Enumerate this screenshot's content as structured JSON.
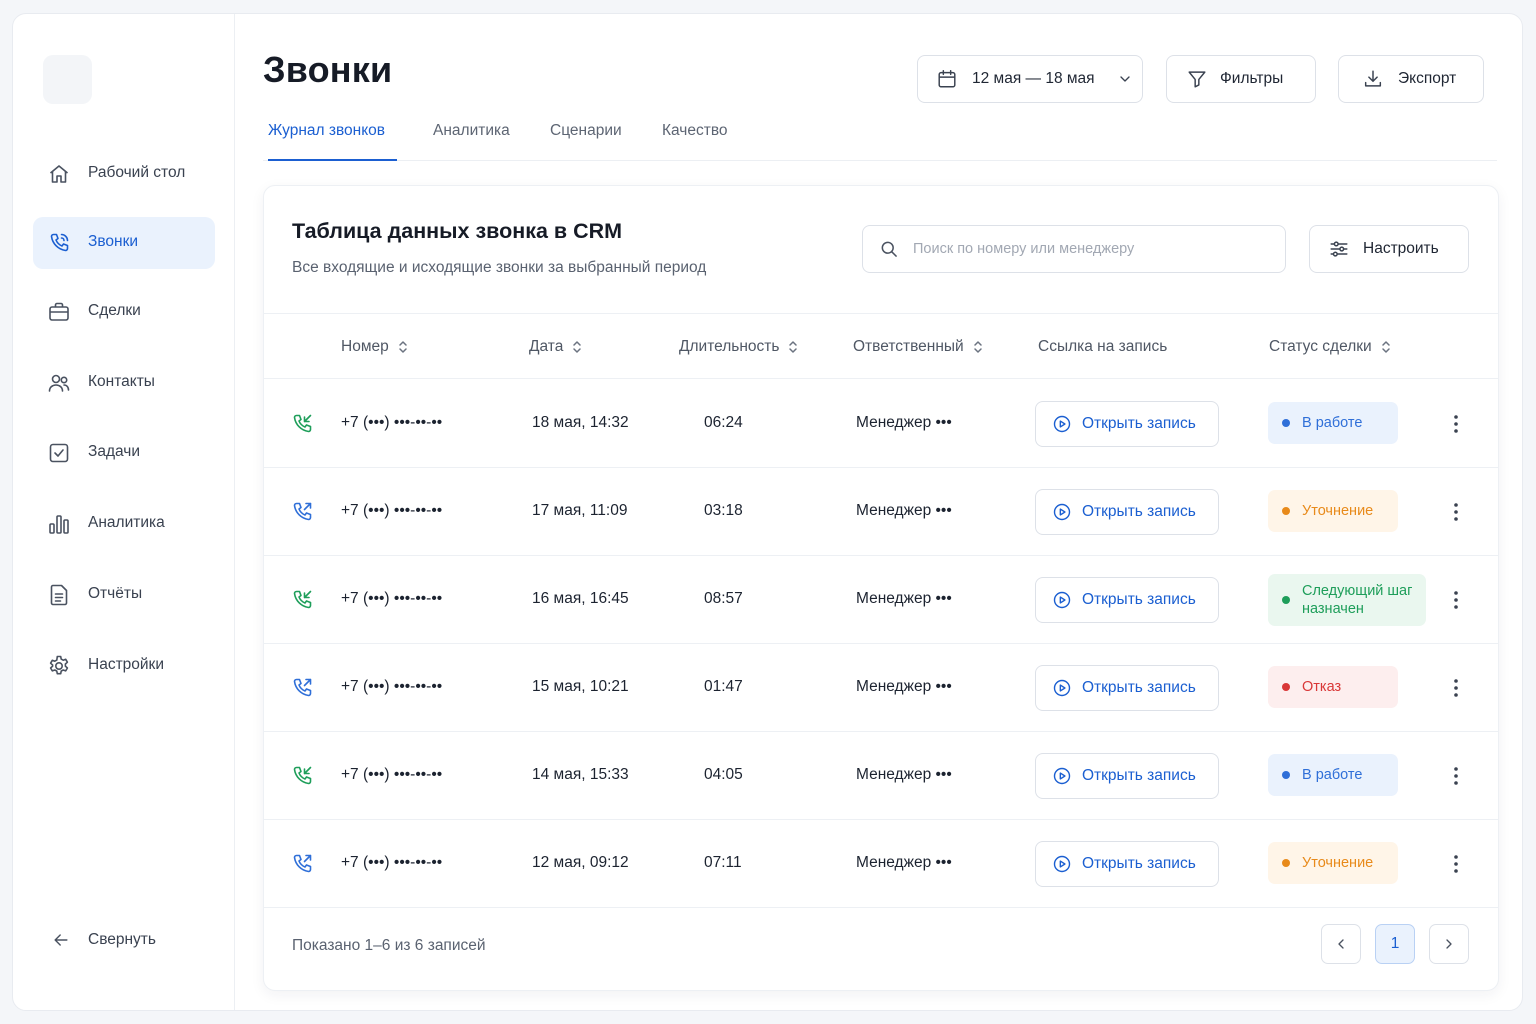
{
  "sidebar": {
    "items": [
      {
        "label": "Рабочий стол",
        "icon": "home-icon"
      },
      {
        "label": "Звонки",
        "icon": "phone-icon",
        "active": true
      },
      {
        "label": "Сделки",
        "icon": "briefcase-icon"
      },
      {
        "label": "Контакты",
        "icon": "users-icon"
      },
      {
        "label": "Задачи",
        "icon": "checkbox-icon"
      },
      {
        "label": "Аналитика",
        "icon": "bar-chart-icon"
      },
      {
        "label": "Отчёты",
        "icon": "document-icon"
      },
      {
        "label": "Настройки",
        "icon": "gear-icon"
      }
    ],
    "collapse_label": "Свернуть"
  },
  "header": {
    "title": "Звонки",
    "date_range": "12 мая — 18 мая",
    "filters_label": "Фильтры",
    "export_label": "Экспорт"
  },
  "tabs": [
    {
      "label": "Журнал звонков",
      "active": true
    },
    {
      "label": "Аналитика"
    },
    {
      "label": "Сценарии"
    },
    {
      "label": "Качество"
    }
  ],
  "card": {
    "title": "Таблица данных звонка в CRM",
    "subtitle": "Все входящие и исходящие звонки за выбранный период",
    "search_placeholder": "Поиск по номеру или менеджеру",
    "configure_label": "Настроить"
  },
  "table": {
    "columns": [
      "Номер",
      "Дата",
      "Длительность",
      "Ответственный",
      "Ссылка на запись",
      "Статус сделки"
    ],
    "record_label": "Открыть запись",
    "rows": [
      {
        "direction": "incoming",
        "number": "+7 (•••) •••-••-••",
        "date": "18 мая, 14:32",
        "duration": "06:24",
        "manager": "Менеджер •••",
        "status": "В работе",
        "status_type": "blue"
      },
      {
        "direction": "outgoing",
        "number": "+7 (•••) •••-••-••",
        "date": "17 мая, 11:09",
        "duration": "03:18",
        "manager": "Менеджер •••",
        "status": "Уточнение",
        "status_type": "orange"
      },
      {
        "direction": "incoming",
        "number": "+7 (•••) •••-••-••",
        "date": "16 мая, 16:45",
        "duration": "08:57",
        "manager": "Менеджер •••",
        "status": "Следующий шаг назначен",
        "status_type": "green"
      },
      {
        "direction": "outgoing",
        "number": "+7 (•••) •••-••-••",
        "date": "15 мая, 10:21",
        "duration": "01:47",
        "manager": "Менеджер •••",
        "status": "Отказ",
        "status_type": "red"
      },
      {
        "direction": "incoming",
        "number": "+7 (•••) •••-••-••",
        "date": "14 мая, 15:33",
        "duration": "04:05",
        "manager": "Менеджер •••",
        "status": "В работе",
        "status_type": "blue"
      },
      {
        "direction": "outgoing",
        "number": "+7 (•••) •••-••-••",
        "date": "12 мая, 09:12",
        "duration": "07:11",
        "manager": "Менеджер •••",
        "status": "Уточнение",
        "status_type": "orange"
      }
    ]
  },
  "footer": {
    "shown_text": "Показано 1–6 из 6 записей",
    "current_page": "1"
  },
  "colors": {
    "accent": "#1b5fd1",
    "incoming_call": "#1e9e5a",
    "outgoing_call": "#2f6fd8",
    "status_blue_bg": "#eaf2fd",
    "status_blue_fg": "#2f6fd8",
    "status_orange_bg": "#fff5e8",
    "status_orange_fg": "#e88a1a",
    "status_green_bg": "#eaf7ef",
    "status_green_fg": "#1e9e5a",
    "status_red_bg": "#fdeeee",
    "status_red_fg": "#d93737"
  }
}
